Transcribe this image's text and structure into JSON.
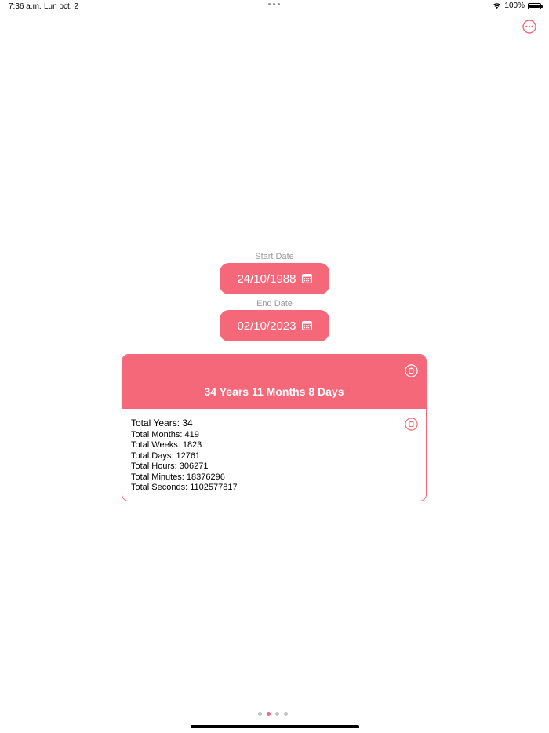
{
  "status_bar": {
    "time": "7:36 a.m.",
    "date": "Lun oct. 2",
    "battery": "100%"
  },
  "menu": {
    "icon": "ellipsis-circle-icon"
  },
  "start_date": {
    "label": "Start Date",
    "value": "24/10/1988",
    "icon": "calendar-icon"
  },
  "end_date": {
    "label": "End Date",
    "value": "02/10/2023",
    "icon": "calendar-icon"
  },
  "result": {
    "summary": "34 Years 11 Months 8 Days",
    "copy_icon": "copy-icon",
    "details": {
      "years": "Total Years: 34",
      "months": "Total Months: 419",
      "weeks": "Total Weeks: 1823",
      "days": "Total Days: 12761",
      "hours": "Total Hours: 306271",
      "minutes": "Total Minutes: 18376296",
      "seconds": "Total Seconds: 1102577817"
    }
  },
  "pager": {
    "count": 4,
    "active_index": 1
  },
  "colors": {
    "accent": "#f4687a",
    "label_gray": "#9a9a9f",
    "background": "#ffffff"
  }
}
